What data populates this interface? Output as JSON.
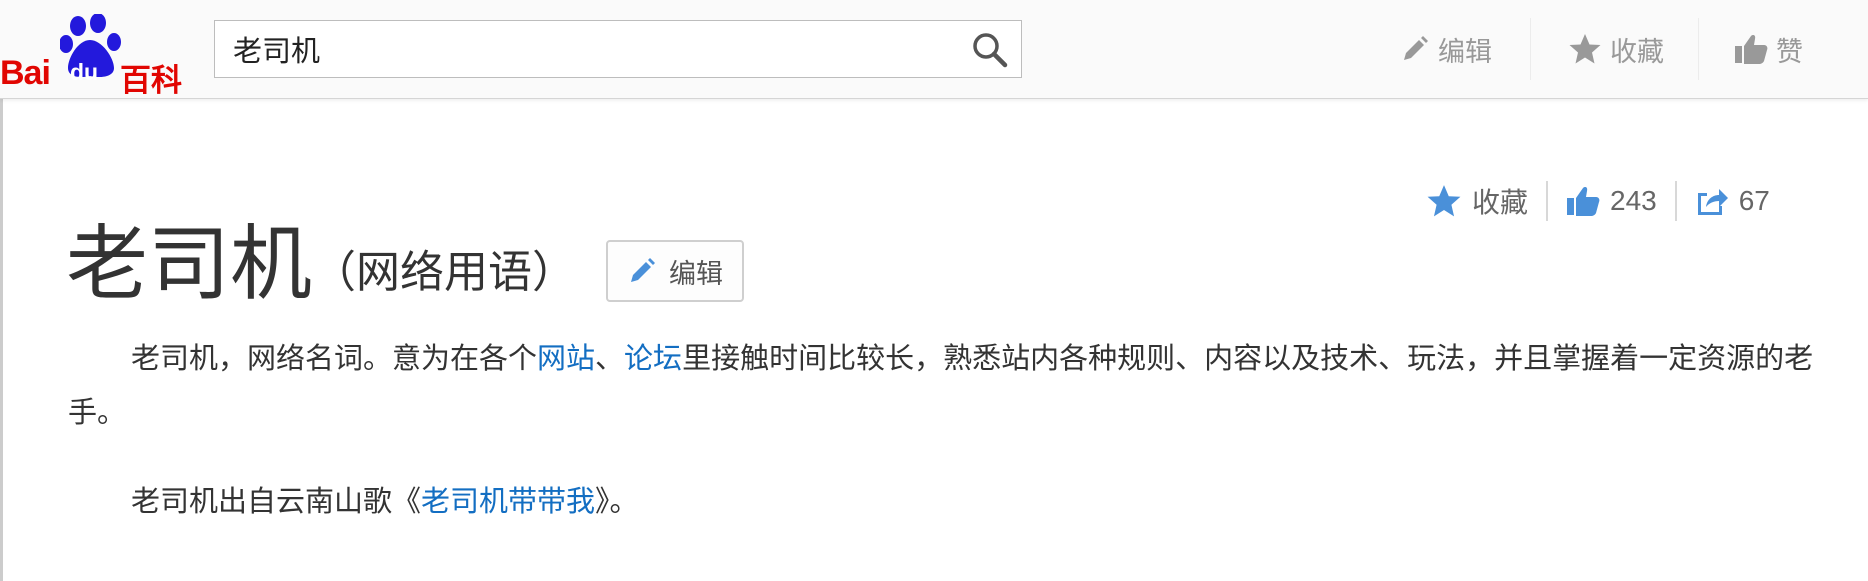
{
  "header": {
    "logo": {
      "bai": "Bai",
      "du": "du",
      "baike": "百科",
      "colors": {
        "brand_red": "#e10602",
        "paw_blue": "#2319dc"
      }
    },
    "search": {
      "value": "老司机",
      "icon": "search-icon"
    },
    "actions": [
      {
        "label": "编辑",
        "icon": "pencil-icon"
      },
      {
        "label": "收藏",
        "icon": "star-icon"
      },
      {
        "label": "赞",
        "icon": "thumbs-up-icon"
      }
    ]
  },
  "stats": {
    "favorite": {
      "label": "收藏",
      "icon": "star-icon"
    },
    "likes": {
      "count": "243",
      "icon": "thumbs-up-icon"
    },
    "shares": {
      "count": "67",
      "icon": "share-icon"
    },
    "accent_color": "#4a90d9"
  },
  "article": {
    "title": "老司机",
    "subtitle": "（网络用语）",
    "edit_label": "编辑",
    "paragraph1": {
      "text_a": "老司机，网络名词。意为在各个",
      "link1": "网站",
      "sep": "、",
      "link2": "论坛",
      "text_b": "里接触时间比较长，熟悉站内各种规则、内容以及技术、玩法，并且掌握着一定资源的老手。"
    },
    "paragraph2": {
      "text_a": "老司机出自云南山歌《",
      "link": "老司机带带我",
      "text_b": "》。"
    },
    "link_color": "#136ec2"
  }
}
